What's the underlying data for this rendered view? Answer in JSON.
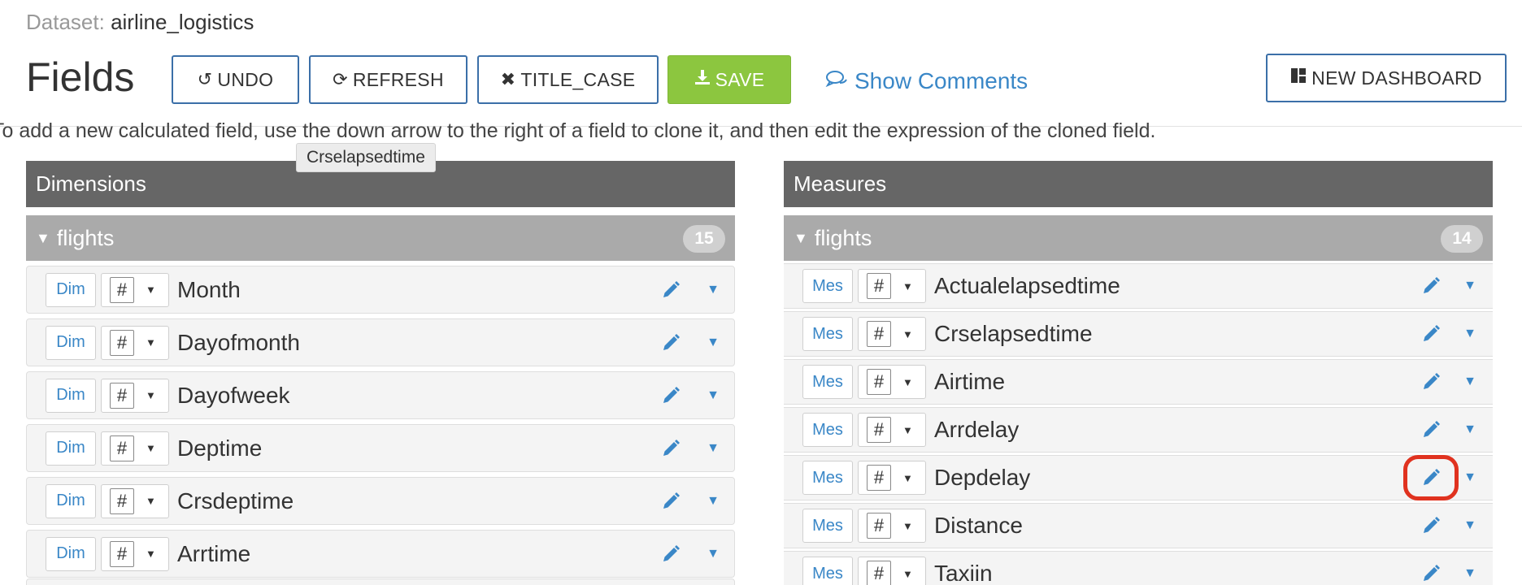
{
  "dataset": {
    "label": "Dataset:",
    "name": "airline_logistics"
  },
  "header": {
    "title": "Fields",
    "undo_label": "UNDO",
    "refresh_label": "REFRESH",
    "titlecase_label": "TITLE_CASE",
    "save_label": "SAVE",
    "show_comments_label": "Show Comments",
    "new_dashboard_label": "NEW DASHBOARD"
  },
  "instructions": "To add a new calculated field, use the down arrow to the right of a field to clone it, and then edit the expression of the cloned field.",
  "tooltip": "Crselapsedtime",
  "dimensions": {
    "title": "Dimensions",
    "group": {
      "name": "flights",
      "count": "15"
    },
    "fields": [
      {
        "role": "Dim",
        "type": "#",
        "name": "Month"
      },
      {
        "role": "Dim",
        "type": "#",
        "name": "Dayofmonth"
      },
      {
        "role": "Dim",
        "type": "#",
        "name": "Dayofweek"
      },
      {
        "role": "Dim",
        "type": "#",
        "name": "Deptime"
      },
      {
        "role": "Dim",
        "type": "#",
        "name": "Crsdeptime"
      },
      {
        "role": "Dim",
        "type": "#",
        "name": "Arrtime"
      }
    ]
  },
  "measures": {
    "title": "Measures",
    "group": {
      "name": "flights",
      "count": "14"
    },
    "fields": [
      {
        "role": "Mes",
        "type": "#",
        "name": "Actualelapsedtime"
      },
      {
        "role": "Mes",
        "type": "#",
        "name": "Crselapsedtime"
      },
      {
        "role": "Mes",
        "type": "#",
        "name": "Airtime"
      },
      {
        "role": "Mes",
        "type": "#",
        "name": "Arrdelay"
      },
      {
        "role": "Mes",
        "type": "#",
        "name": "Depdelay"
      },
      {
        "role": "Mes",
        "type": "#",
        "name": "Distance"
      },
      {
        "role": "Mes",
        "type": "#",
        "name": "Taxiin"
      }
    ]
  },
  "icons": {
    "undo": "undo-icon",
    "refresh": "refresh-icon",
    "titlecase": "close-icon",
    "save": "download-icon",
    "comments": "comments-icon",
    "dashboard": "dashboard-icon",
    "edit": "pencil-icon",
    "dropdown": "caret-down-icon"
  },
  "colors": {
    "accent": "#3a87c7",
    "save": "#8cc63f",
    "panel_header": "#666666",
    "group_header": "#aaaaaa",
    "highlight": "#e0321f"
  },
  "highlighted_field": "Depdelay"
}
